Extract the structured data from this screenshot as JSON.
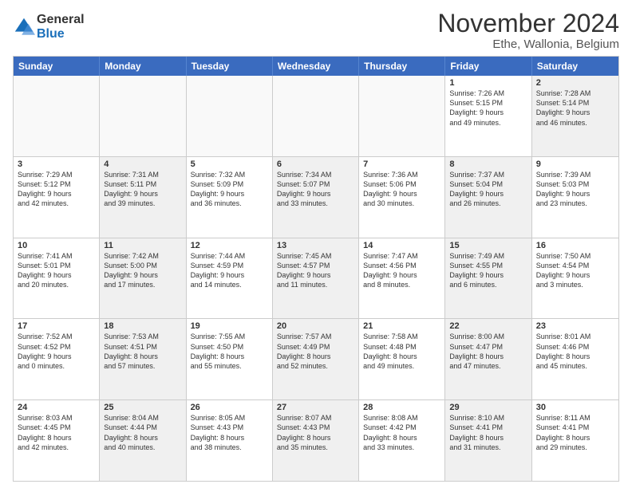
{
  "logo": {
    "general": "General",
    "blue": "Blue"
  },
  "title": "November 2024",
  "location": "Ethe, Wallonia, Belgium",
  "headers": [
    "Sunday",
    "Monday",
    "Tuesday",
    "Wednesday",
    "Thursday",
    "Friday",
    "Saturday"
  ],
  "rows": [
    [
      {
        "day": "",
        "text": "",
        "empty": true
      },
      {
        "day": "",
        "text": "",
        "empty": true
      },
      {
        "day": "",
        "text": "",
        "empty": true
      },
      {
        "day": "",
        "text": "",
        "empty": true
      },
      {
        "day": "",
        "text": "",
        "empty": true
      },
      {
        "day": "1",
        "text": "Sunrise: 7:26 AM\nSunset: 5:15 PM\nDaylight: 9 hours\nand 49 minutes.",
        "empty": false,
        "shaded": false
      },
      {
        "day": "2",
        "text": "Sunrise: 7:28 AM\nSunset: 5:14 PM\nDaylight: 9 hours\nand 46 minutes.",
        "empty": false,
        "shaded": true
      }
    ],
    [
      {
        "day": "3",
        "text": "Sunrise: 7:29 AM\nSunset: 5:12 PM\nDaylight: 9 hours\nand 42 minutes.",
        "empty": false,
        "shaded": false
      },
      {
        "day": "4",
        "text": "Sunrise: 7:31 AM\nSunset: 5:11 PM\nDaylight: 9 hours\nand 39 minutes.",
        "empty": false,
        "shaded": true
      },
      {
        "day": "5",
        "text": "Sunrise: 7:32 AM\nSunset: 5:09 PM\nDaylight: 9 hours\nand 36 minutes.",
        "empty": false,
        "shaded": false
      },
      {
        "day": "6",
        "text": "Sunrise: 7:34 AM\nSunset: 5:07 PM\nDaylight: 9 hours\nand 33 minutes.",
        "empty": false,
        "shaded": true
      },
      {
        "day": "7",
        "text": "Sunrise: 7:36 AM\nSunset: 5:06 PM\nDaylight: 9 hours\nand 30 minutes.",
        "empty": false,
        "shaded": false
      },
      {
        "day": "8",
        "text": "Sunrise: 7:37 AM\nSunset: 5:04 PM\nDaylight: 9 hours\nand 26 minutes.",
        "empty": false,
        "shaded": true
      },
      {
        "day": "9",
        "text": "Sunrise: 7:39 AM\nSunset: 5:03 PM\nDaylight: 9 hours\nand 23 minutes.",
        "empty": false,
        "shaded": false
      }
    ],
    [
      {
        "day": "10",
        "text": "Sunrise: 7:41 AM\nSunset: 5:01 PM\nDaylight: 9 hours\nand 20 minutes.",
        "empty": false,
        "shaded": false
      },
      {
        "day": "11",
        "text": "Sunrise: 7:42 AM\nSunset: 5:00 PM\nDaylight: 9 hours\nand 17 minutes.",
        "empty": false,
        "shaded": true
      },
      {
        "day": "12",
        "text": "Sunrise: 7:44 AM\nSunset: 4:59 PM\nDaylight: 9 hours\nand 14 minutes.",
        "empty": false,
        "shaded": false
      },
      {
        "day": "13",
        "text": "Sunrise: 7:45 AM\nSunset: 4:57 PM\nDaylight: 9 hours\nand 11 minutes.",
        "empty": false,
        "shaded": true
      },
      {
        "day": "14",
        "text": "Sunrise: 7:47 AM\nSunset: 4:56 PM\nDaylight: 9 hours\nand 8 minutes.",
        "empty": false,
        "shaded": false
      },
      {
        "day": "15",
        "text": "Sunrise: 7:49 AM\nSunset: 4:55 PM\nDaylight: 9 hours\nand 6 minutes.",
        "empty": false,
        "shaded": true
      },
      {
        "day": "16",
        "text": "Sunrise: 7:50 AM\nSunset: 4:54 PM\nDaylight: 9 hours\nand 3 minutes.",
        "empty": false,
        "shaded": false
      }
    ],
    [
      {
        "day": "17",
        "text": "Sunrise: 7:52 AM\nSunset: 4:52 PM\nDaylight: 9 hours\nand 0 minutes.",
        "empty": false,
        "shaded": false
      },
      {
        "day": "18",
        "text": "Sunrise: 7:53 AM\nSunset: 4:51 PM\nDaylight: 8 hours\nand 57 minutes.",
        "empty": false,
        "shaded": true
      },
      {
        "day": "19",
        "text": "Sunrise: 7:55 AM\nSunset: 4:50 PM\nDaylight: 8 hours\nand 55 minutes.",
        "empty": false,
        "shaded": false
      },
      {
        "day": "20",
        "text": "Sunrise: 7:57 AM\nSunset: 4:49 PM\nDaylight: 8 hours\nand 52 minutes.",
        "empty": false,
        "shaded": true
      },
      {
        "day": "21",
        "text": "Sunrise: 7:58 AM\nSunset: 4:48 PM\nDaylight: 8 hours\nand 49 minutes.",
        "empty": false,
        "shaded": false
      },
      {
        "day": "22",
        "text": "Sunrise: 8:00 AM\nSunset: 4:47 PM\nDaylight: 8 hours\nand 47 minutes.",
        "empty": false,
        "shaded": true
      },
      {
        "day": "23",
        "text": "Sunrise: 8:01 AM\nSunset: 4:46 PM\nDaylight: 8 hours\nand 45 minutes.",
        "empty": false,
        "shaded": false
      }
    ],
    [
      {
        "day": "24",
        "text": "Sunrise: 8:03 AM\nSunset: 4:45 PM\nDaylight: 8 hours\nand 42 minutes.",
        "empty": false,
        "shaded": false
      },
      {
        "day": "25",
        "text": "Sunrise: 8:04 AM\nSunset: 4:44 PM\nDaylight: 8 hours\nand 40 minutes.",
        "empty": false,
        "shaded": true
      },
      {
        "day": "26",
        "text": "Sunrise: 8:05 AM\nSunset: 4:43 PM\nDaylight: 8 hours\nand 38 minutes.",
        "empty": false,
        "shaded": false
      },
      {
        "day": "27",
        "text": "Sunrise: 8:07 AM\nSunset: 4:43 PM\nDaylight: 8 hours\nand 35 minutes.",
        "empty": false,
        "shaded": true
      },
      {
        "day": "28",
        "text": "Sunrise: 8:08 AM\nSunset: 4:42 PM\nDaylight: 8 hours\nand 33 minutes.",
        "empty": false,
        "shaded": false
      },
      {
        "day": "29",
        "text": "Sunrise: 8:10 AM\nSunset: 4:41 PM\nDaylight: 8 hours\nand 31 minutes.",
        "empty": false,
        "shaded": true
      },
      {
        "day": "30",
        "text": "Sunrise: 8:11 AM\nSunset: 4:41 PM\nDaylight: 8 hours\nand 29 minutes.",
        "empty": false,
        "shaded": false
      }
    ]
  ]
}
